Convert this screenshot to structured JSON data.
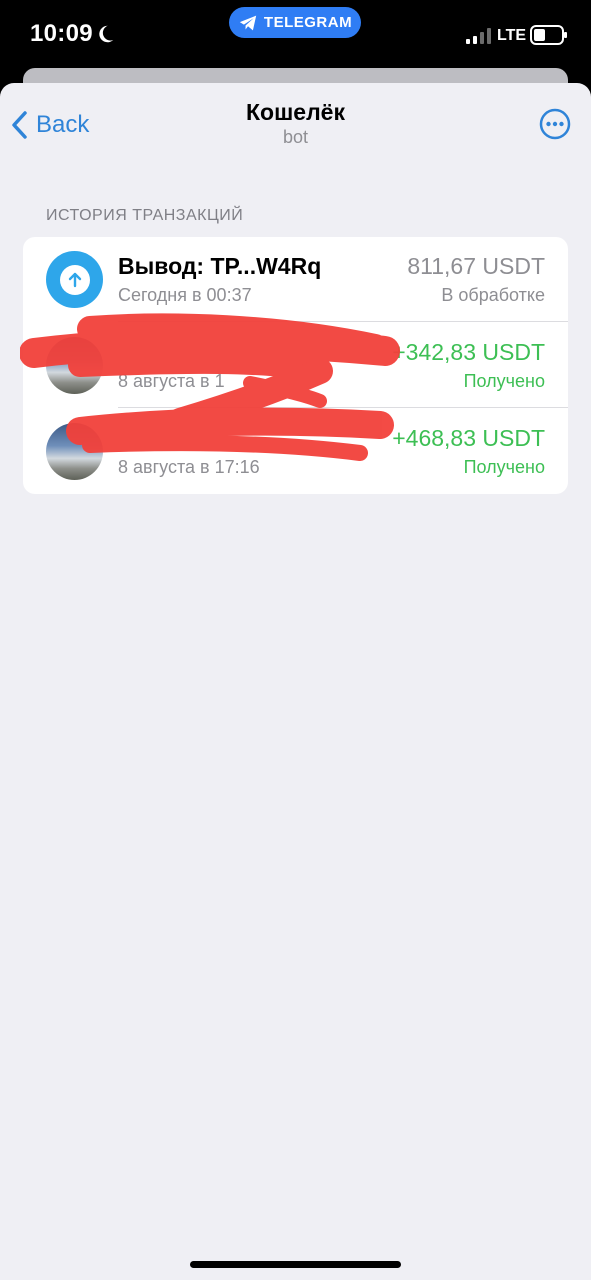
{
  "status_bar": {
    "time": "10:09",
    "app_pill": "TELEGRAM",
    "network": "LTE",
    "icons": [
      "moon-icon",
      "telegram-icon",
      "signal-icon",
      "battery-icon"
    ]
  },
  "nav": {
    "back_label": "Back",
    "title": "Кошелёк",
    "subtitle": "bot",
    "more_icon": "ellipsis-circle-icon"
  },
  "section": {
    "header": "ИСТОРИЯ ТРАНЗАКЦИЙ"
  },
  "transactions": [
    {
      "title": "Вывод: TP...W4Rq",
      "subtitle": "Сегодня в 00:37",
      "amount": "811,67 USDT",
      "status": "В обработке",
      "icon": "arrow-up-icon"
    },
    {
      "title": "",
      "subtitle": "8 августа в 1",
      "amount": "+342,83 USDT",
      "status": "Получено",
      "icon": "avatar-photo"
    },
    {
      "title": "",
      "subtitle": "8 августа в 17:16",
      "amount": "+468,83 USDT",
      "status": "Получено",
      "icon": "avatar-photo"
    }
  ],
  "colors": {
    "accent": "#2f84d8",
    "pill": "#2f7df4",
    "received": "#3dbf54",
    "muted": "#8e8e93",
    "background": "#efeff4",
    "redaction": "#f2413b"
  }
}
